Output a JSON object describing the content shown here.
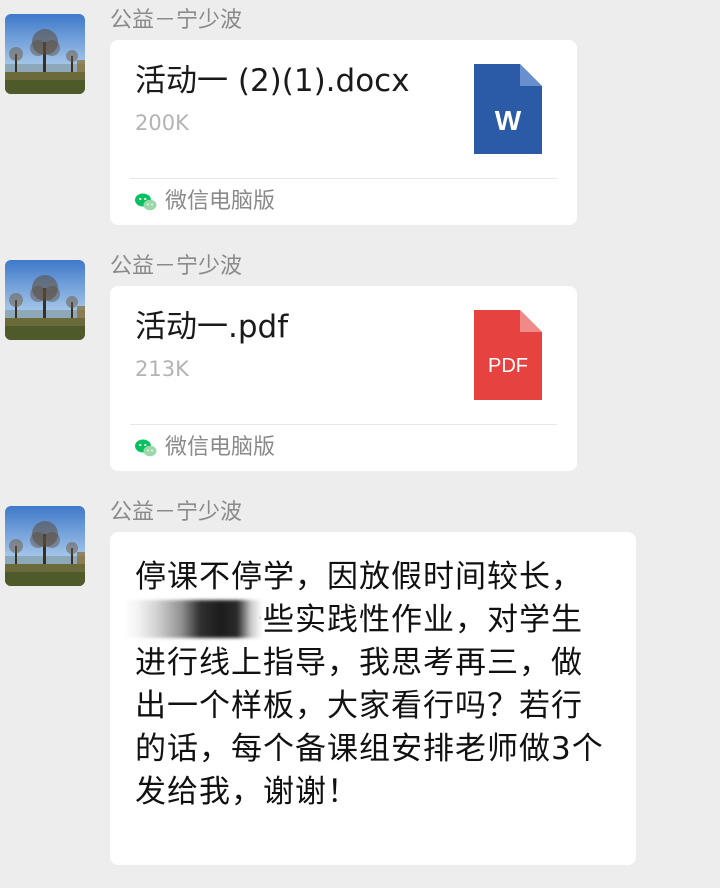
{
  "messages": [
    {
      "type": "file",
      "sender": "公益－宁少波",
      "file_name": "活动一 (2)(1).docx",
      "file_size": "200K",
      "file_icon": "word-file-icon",
      "file_icon_label": "W",
      "file_icon_color": "#2b5aa6",
      "source_label": "微信电脑版"
    },
    {
      "type": "file",
      "sender": "公益－宁少波",
      "file_name": "活动一.pdf",
      "file_size": "213K",
      "file_icon": "pdf-file-icon",
      "file_icon_label": "PDF",
      "file_icon_color": "#e64340",
      "source_label": "微信电脑版"
    },
    {
      "type": "text",
      "sender": "公益－宁少波",
      "text": "停课不停学，因放假时间较长，我们多一些实践性作业，对学生进行线上指导，我思考再三，做出一个样板，大家看行吗？若行的话，每个备课组安排老师做3个发给我，谢谢！"
    }
  ],
  "colors": {
    "background": "#ededed",
    "bubble": "#ffffff",
    "sender_text": "#8a8a8a",
    "wechat_green": "#07c160"
  }
}
